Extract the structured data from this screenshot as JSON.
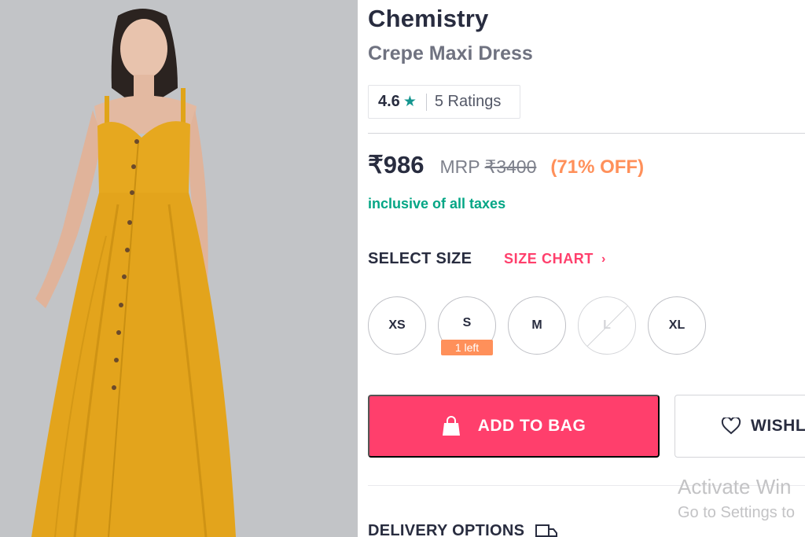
{
  "product": {
    "brand": "Chemistry",
    "name": "Crepe Maxi Dress",
    "image_alt": "Model wearing yellow crepe maxi dress"
  },
  "ratings": {
    "value": "4.6",
    "count_label": "5 Ratings",
    "icon": "star-icon"
  },
  "pricing": {
    "price": "₹986",
    "mrp_label": "MRP",
    "mrp_value": "₹3400",
    "discount": "(71% OFF)",
    "tax_note": "inclusive of all taxes"
  },
  "sizes": {
    "heading": "SELECT SIZE",
    "chart_link": "SIZE CHART",
    "options": [
      {
        "label": "XS",
        "available": true
      },
      {
        "label": "S",
        "available": true,
        "badge": "1 left"
      },
      {
        "label": "M",
        "available": true
      },
      {
        "label": "L",
        "available": false
      },
      {
        "label": "XL",
        "available": true
      }
    ]
  },
  "actions": {
    "add_to_bag": "ADD TO BAG",
    "wishlist": "WISHL"
  },
  "delivery": {
    "heading": "DELIVERY OPTIONS"
  },
  "watermark": {
    "title": "Activate Win",
    "subtitle": "Go to Settings to"
  },
  "colors": {
    "accent": "#ff3f6c",
    "discount": "#ff905a",
    "tax": "#03a685",
    "star": "#14958f",
    "dress": "#e6a81f"
  }
}
